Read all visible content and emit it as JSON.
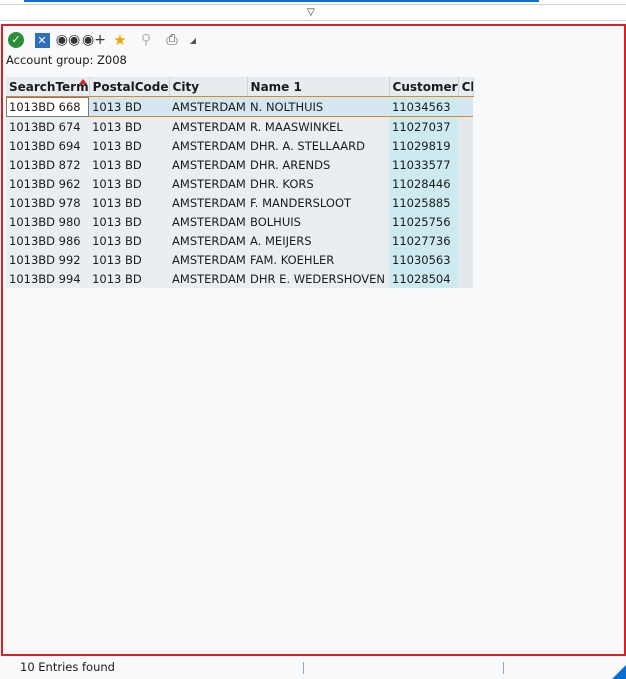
{
  "toolbar": {
    "icons": [
      "check-icon",
      "cancel-icon",
      "binoculars-icon",
      "binoculars-plus-icon",
      "favorite-add-icon",
      "settings-icon",
      "print-icon"
    ]
  },
  "header": {
    "account_group": "Account group: Z008"
  },
  "grid": {
    "columns": [
      "SearchTerm",
      "PostalCode",
      "City",
      "Name 1",
      "Customer",
      "Cl"
    ],
    "rows": [
      [
        "1013BD 668",
        "1013 BD",
        "AMSTERDAM",
        "N. NOLTHUIS",
        "11034563",
        ""
      ],
      [
        "1013BD 674",
        "1013 BD",
        "AMSTERDAM",
        "R. MAASWINKEL",
        "11027037",
        ""
      ],
      [
        "1013BD 694",
        "1013 BD",
        "AMSTERDAM",
        "DHR. A. STELLAARD",
        "11029819",
        ""
      ],
      [
        "1013BD 872",
        "1013 BD",
        "AMSTERDAM",
        "DHR. ARENDS",
        "11033577",
        ""
      ],
      [
        "1013BD 962",
        "1013 BD",
        "AMSTERDAM",
        "DHR. KORS",
        "11028446",
        ""
      ],
      [
        "1013BD 978",
        "1013 BD",
        "AMSTERDAM",
        "F. MANDERSLOOT",
        "11025885",
        ""
      ],
      [
        "1013BD 980",
        "1013 BD",
        "AMSTERDAM",
        "BOLHUIS",
        "11025756",
        ""
      ],
      [
        "1013BD 986",
        "1013 BD",
        "AMSTERDAM",
        "A. MEIJERS",
        "11027736",
        ""
      ],
      [
        "1013BD 992",
        "1013 BD",
        "AMSTERDAM",
        "FAM. KOEHLER",
        "11030563",
        ""
      ],
      [
        "1013BD 994",
        "1013 BD",
        "AMSTERDAM",
        "DHR  E. WEDERSHOVEN",
        "11028504",
        ""
      ]
    ]
  },
  "status": {
    "text": "10 Entries found"
  },
  "colors": {
    "frame": "#d6212b",
    "accent": "#0a6ed1",
    "key_column": "#cdeaf0"
  }
}
